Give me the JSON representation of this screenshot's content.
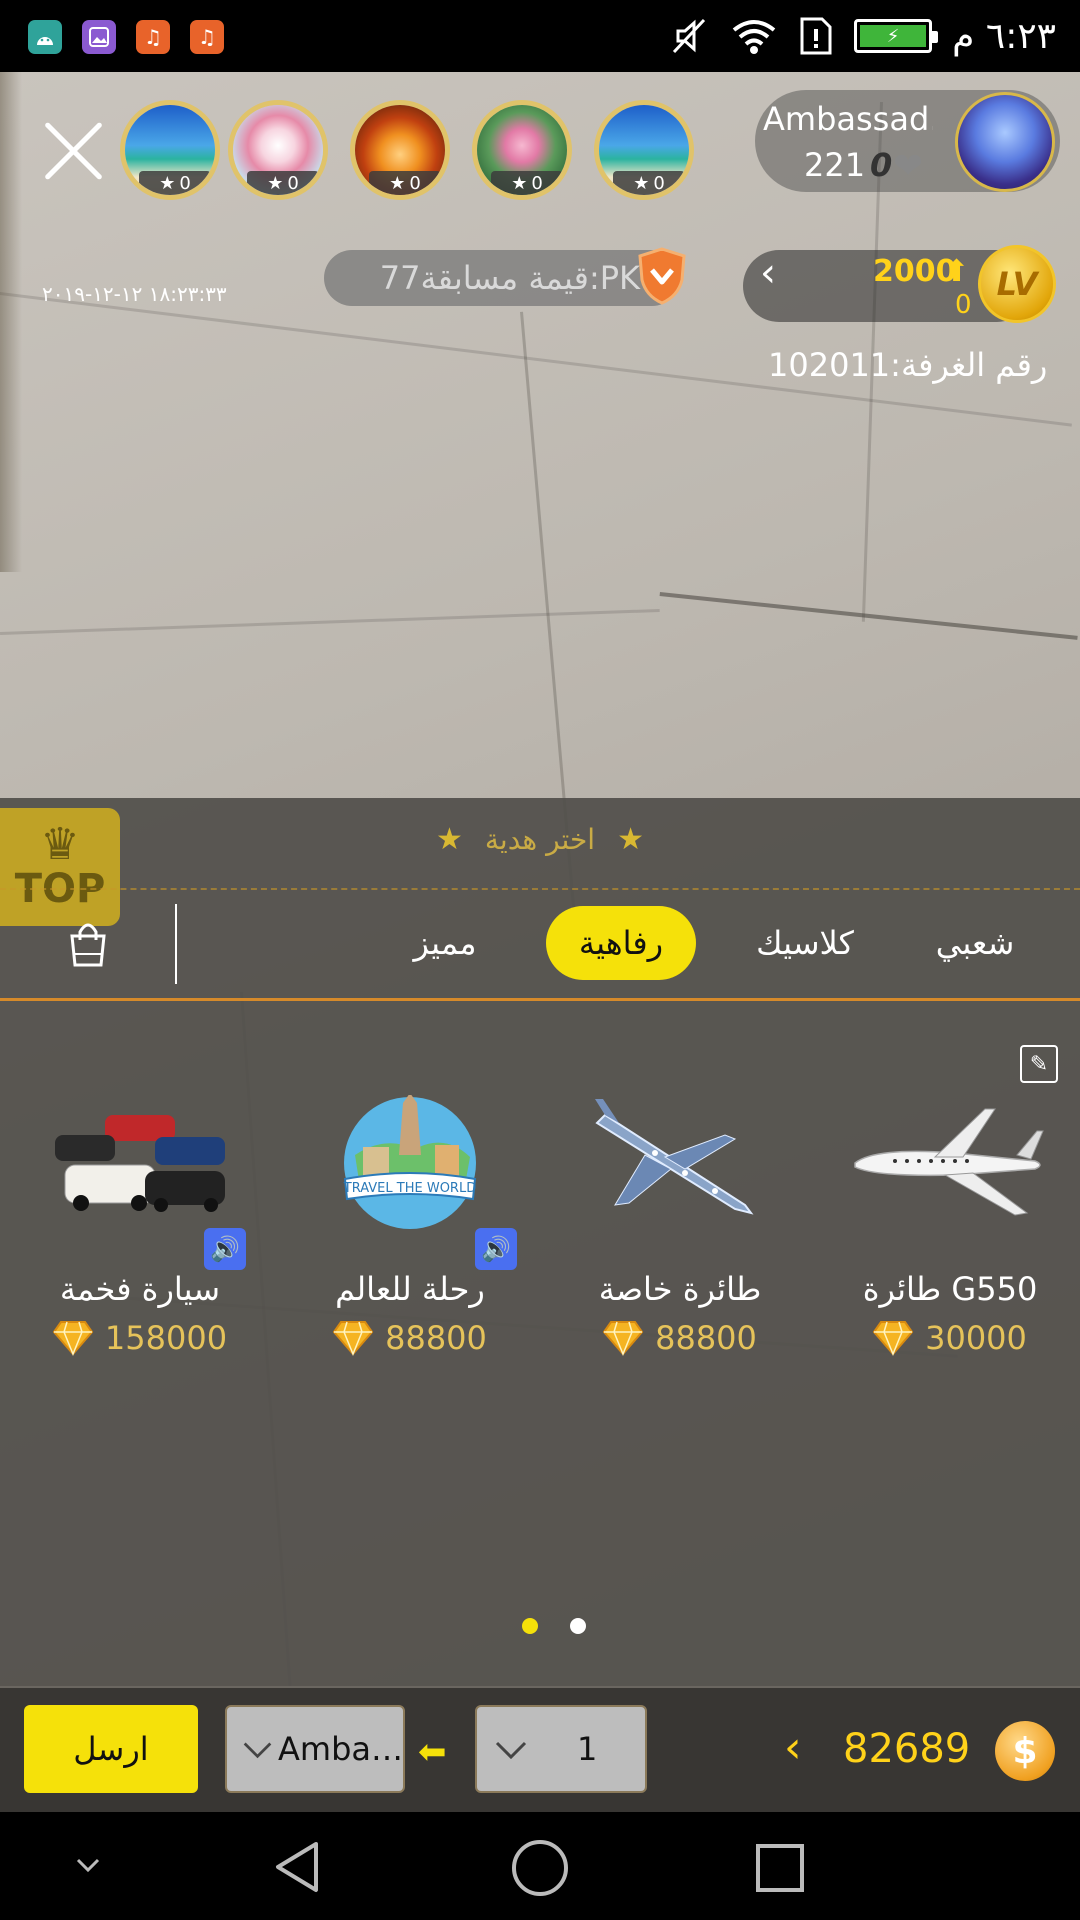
{
  "status_bar": {
    "time": "٦:٢٣ م",
    "app_icons": [
      "android-icon",
      "gallery-icon",
      "music-icon",
      "music-icon"
    ],
    "system_icons": [
      "mute-icon",
      "wifi-icon",
      "sim-icon",
      "battery-icon"
    ]
  },
  "viewers": [
    {
      "count": "0",
      "theme": "beach"
    },
    {
      "count": "0",
      "theme": "flowers"
    },
    {
      "count": "0",
      "theme": "fish"
    },
    {
      "count": "0",
      "theme": "lotus"
    },
    {
      "count": "0",
      "theme": "beach"
    }
  ],
  "host": {
    "name": "Ambassad…",
    "followers": "221",
    "likes": "0"
  },
  "level": {
    "value": "2000",
    "sub": "0",
    "badge": "LV"
  },
  "pk": {
    "label": "قيمة مسابقة77:PK"
  },
  "date": "١٨:٢٣:٣٣ ١٢-١٢-٢٠١٩",
  "room": {
    "label": "رقم الغرفة:102011"
  },
  "panel": {
    "top_badge": "TOP",
    "choose_label": "اختر هدية",
    "tabs": [
      {
        "label": "شعبي"
      },
      {
        "label": "كلاسيك"
      },
      {
        "label": "رفاهية"
      },
      {
        "label": "مميز"
      }
    ],
    "active_tab": "رفاهية",
    "gifts": [
      {
        "name": "طائرة G550",
        "price": "30000"
      },
      {
        "name": "طائرة خاصة",
        "price": "88800"
      },
      {
        "name": "رحلة للعالم",
        "price": "88800"
      },
      {
        "name": "سيارة فخمة",
        "price": "158000"
      }
    ],
    "travel_caption": "TRAVEL THE WORLD",
    "page_count": 2,
    "active_page": 1
  },
  "bottom": {
    "send_label": "ارسل",
    "recipient": "Amba…",
    "quantity": "1",
    "balance": "82689",
    "coin_symbol": "$"
  },
  "colors": {
    "accent_yellow": "#f5e10a",
    "gold": "#e6c35a",
    "tab_underline": "#d68a2a",
    "audio_blue": "#4a6ff0"
  }
}
